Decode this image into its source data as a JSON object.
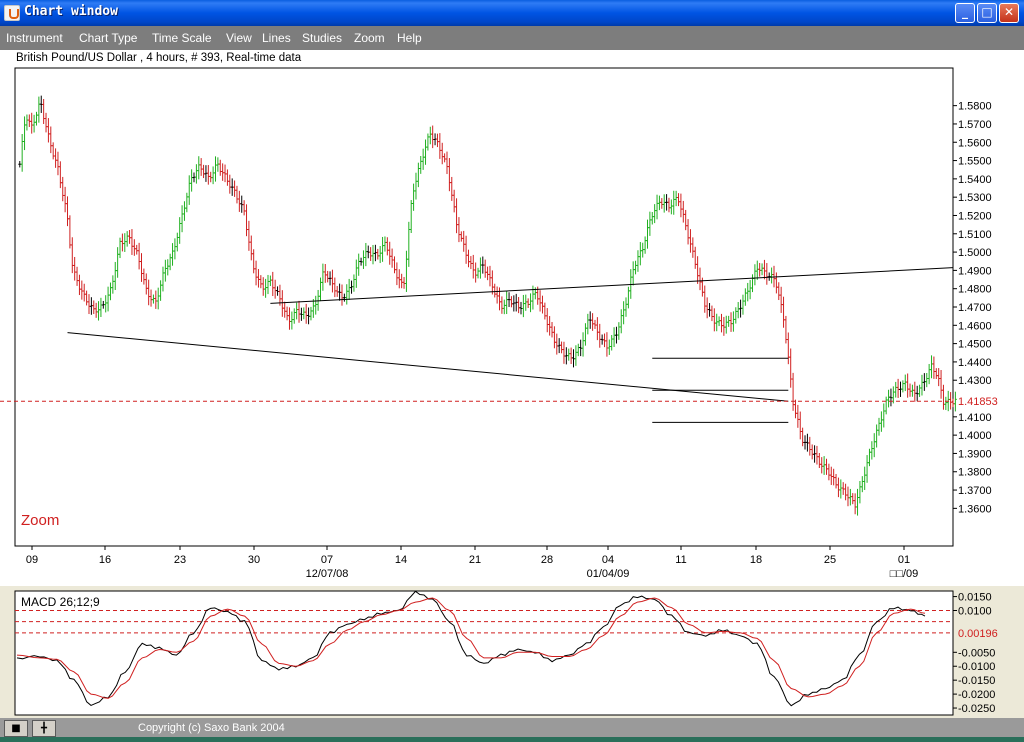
{
  "window": {
    "title": "Chart window"
  },
  "menu": [
    "Instrument",
    "Chart Type",
    "Time Scale",
    "View",
    "Lines",
    "Studies",
    "Zoom",
    "Help"
  ],
  "chart_header": "British Pound/US Dollar , 4 hours, # 393, Real-time data",
  "zoom_label": "Zoom",
  "macd_label": "MACD 26;12;9",
  "status": {
    "copyright": "Copyright (c) Saxo Bank 2004"
  },
  "colors": {
    "up_bar": "#20b020",
    "down_bar": "#d02020",
    "neutral_bar": "#000000",
    "ref_line": "#d02020",
    "signal": "#d02020"
  },
  "chart_data": [
    {
      "type": "ohlc",
      "instrument": "British Pound/US Dollar",
      "timeframe": "4 hours",
      "y_ticks": [
        "1.5800",
        "1.5700",
        "1.5600",
        "1.5500",
        "1.5400",
        "1.5300",
        "1.5200",
        "1.5100",
        "1.5000",
        "1.4900",
        "1.4800",
        "1.4700",
        "1.4600",
        "1.4500",
        "1.4400",
        "1.4300",
        "1.4100",
        "1.4000",
        "1.3900",
        "1.3800",
        "1.3700",
        "1.3600"
      ],
      "ylim": [
        1.352,
        1.588
      ],
      "x_ticks": [
        "09",
        "16",
        "23",
        "30",
        "07",
        "14",
        "21",
        "28",
        "04",
        "11",
        "18",
        "25",
        "01"
      ],
      "x_major": [
        "12/07/08",
        "01/04/09",
        "□□/09"
      ],
      "current_price": "1.41853",
      "current_value": 1.41853,
      "anchors": [
        [
          0,
          1.548
        ],
        [
          2,
          1.575
        ],
        [
          4,
          1.568
        ],
        [
          7,
          1.582
        ],
        [
          10,
          1.561
        ],
        [
          13,
          1.545
        ],
        [
          16,
          1.52
        ],
        [
          18,
          1.49
        ],
        [
          20,
          1.482
        ],
        [
          22,
          1.475
        ],
        [
          25,
          1.468
        ],
        [
          28,
          1.47
        ],
        [
          31,
          1.48
        ],
        [
          34,
          1.505
        ],
        [
          37,
          1.508
        ],
        [
          40,
          1.498
        ],
        [
          43,
          1.478
        ],
        [
          46,
          1.472
        ],
        [
          49,
          1.49
        ],
        [
          52,
          1.5
        ],
        [
          55,
          1.52
        ],
        [
          58,
          1.54
        ],
        [
          61,
          1.547
        ],
        [
          64,
          1.54
        ],
        [
          67,
          1.548
        ],
        [
          70,
          1.54
        ],
        [
          73,
          1.532
        ],
        [
          76,
          1.522
        ],
        [
          79,
          1.492
        ],
        [
          82,
          1.48
        ],
        [
          85,
          1.484
        ],
        [
          88,
          1.475
        ],
        [
          91,
          1.462
        ],
        [
          94,
          1.468
        ],
        [
          97,
          1.465
        ],
        [
          100,
          1.47
        ],
        [
          103,
          1.49
        ],
        [
          106,
          1.482
        ],
        [
          109,
          1.475
        ],
        [
          112,
          1.48
        ],
        [
          115,
          1.495
        ],
        [
          118,
          1.5
        ],
        [
          121,
          1.498
        ],
        [
          124,
          1.505
        ],
        [
          127,
          1.49
        ],
        [
          130,
          1.48
        ],
        [
          133,
          1.532
        ],
        [
          136,
          1.55
        ],
        [
          139,
          1.565
        ],
        [
          142,
          1.558
        ],
        [
          145,
          1.545
        ],
        [
          148,
          1.515
        ],
        [
          151,
          1.5
        ],
        [
          154,
          1.488
        ],
        [
          157,
          1.493
        ],
        [
          160,
          1.482
        ],
        [
          163,
          1.47
        ],
        [
          166,
          1.474
        ],
        [
          169,
          1.47
        ],
        [
          172,
          1.472
        ],
        [
          175,
          1.478
        ],
        [
          178,
          1.465
        ],
        [
          181,
          1.452
        ],
        [
          184,
          1.445
        ],
        [
          187,
          1.442
        ],
        [
          190,
          1.448
        ],
        [
          193,
          1.465
        ],
        [
          196,
          1.455
        ],
        [
          199,
          1.448
        ],
        [
          202,
          1.455
        ],
        [
          205,
          1.47
        ],
        [
          208,
          1.492
        ],
        [
          211,
          1.502
        ],
        [
          214,
          1.52
        ],
        [
          217,
          1.528
        ],
        [
          220,
          1.525
        ],
        [
          223,
          1.53
        ],
        [
          226,
          1.512
        ],
        [
          229,
          1.493
        ],
        [
          232,
          1.472
        ],
        [
          235,
          1.463
        ],
        [
          238,
          1.46
        ],
        [
          241,
          1.462
        ],
        [
          244,
          1.47
        ],
        [
          247,
          1.48
        ],
        [
          250,
          1.492
        ],
        [
          253,
          1.488
        ],
        [
          256,
          1.485
        ],
        [
          259,
          1.462
        ],
        [
          262,
          1.418
        ],
        [
          265,
          1.398
        ],
        [
          268,
          1.392
        ],
        [
          271,
          1.385
        ],
        [
          274,
          1.38
        ],
        [
          277,
          1.372
        ],
        [
          280,
          1.368
        ],
        [
          283,
          1.362
        ],
        [
          285,
          1.372
        ],
        [
          288,
          1.39
        ],
        [
          291,
          1.405
        ],
        [
          294,
          1.42
        ],
        [
          297,
          1.425
        ],
        [
          300,
          1.428
        ],
        [
          303,
          1.422
        ],
        [
          306,
          1.428
        ],
        [
          309,
          1.438
        ],
        [
          311,
          1.432
        ],
        [
          313,
          1.418
        ],
        [
          315,
          1.418
        ],
        [
          317,
          1.419
        ]
      ],
      "trendlines": [
        {
          "from": [
            105,
            1.472
          ],
          "to": [
            393,
            1.4915
          ]
        },
        {
          "from": [
            20,
            1.456
          ],
          "to": [
            322,
            1.4185
          ]
        },
        {
          "from": [
            265,
            1.442
          ],
          "to": [
            322,
            1.442
          ]
        },
        {
          "from": [
            265,
            1.4245
          ],
          "to": [
            322,
            1.4245
          ]
        },
        {
          "from": [
            265,
            1.407
          ],
          "to": [
            322,
            1.407
          ]
        }
      ]
    },
    {
      "type": "line",
      "title": "MACD 26;12;9",
      "y_ticks": [
        "0.0150",
        "0.0100",
        "-0.0050",
        "-0.0100",
        "-0.0150",
        "-0.0200",
        "-0.0250"
      ],
      "ylim": [
        -0.0275,
        0.017
      ],
      "current_value_label": "0.00196",
      "reference_levels": [
        0.01,
        0.006,
        0.00196
      ],
      "series": [
        {
          "values": [
            [
              0,
              -0.007
            ],
            [
              8,
              -0.0065
            ],
            [
              14,
              -0.008
            ],
            [
              20,
              -0.015
            ],
            [
              26,
              -0.024
            ],
            [
              32,
              -0.021
            ],
            [
              38,
              -0.012
            ],
            [
              44,
              -0.002
            ],
            [
              50,
              -0.0035
            ],
            [
              56,
              -0.006
            ],
            [
              62,
              0.002
            ],
            [
              68,
              0.011
            ],
            [
              74,
              0.0095
            ],
            [
              80,
              0.006
            ],
            [
              86,
              -0.008
            ],
            [
              92,
              -0.011
            ],
            [
              98,
              -0.01
            ],
            [
              104,
              -0.007
            ],
            [
              110,
              0.002
            ],
            [
              116,
              0.005
            ],
            [
              122,
              0.007
            ],
            [
              128,
              0.009
            ],
            [
              134,
              0.01
            ],
            [
              140,
              0.0165
            ],
            [
              146,
              0.014
            ],
            [
              152,
              0.006
            ],
            [
              158,
              -0.006
            ],
            [
              164,
              -0.009
            ],
            [
              170,
              -0.006
            ],
            [
              176,
              -0.004
            ],
            [
              182,
              -0.005
            ],
            [
              188,
              -0.008
            ],
            [
              194,
              -0.006
            ],
            [
              200,
              -0.002
            ],
            [
              206,
              0.004
            ],
            [
              212,
              0.012
            ],
            [
              218,
              0.015
            ],
            [
              224,
              0.014
            ],
            [
              230,
              0.008
            ],
            [
              236,
              0.002
            ],
            [
              242,
              0.001
            ],
            [
              248,
              0.003
            ],
            [
              254,
              0.001
            ],
            [
              260,
              -0.002
            ],
            [
              266,
              -0.014
            ],
            [
              272,
              -0.024
            ],
            [
              278,
              -0.02
            ],
            [
              284,
              -0.018
            ],
            [
              290,
              -0.015
            ],
            [
              296,
              -0.006
            ],
            [
              302,
              0.006
            ],
            [
              308,
              0.011
            ],
            [
              314,
              0.01
            ],
            [
              319,
              0.008
            ]
          ]
        },
        {
          "values": [
            [
              0,
              -0.006
            ],
            [
              8,
              -0.007
            ],
            [
              14,
              -0.0075
            ],
            [
              20,
              -0.012
            ],
            [
              26,
              -0.02
            ],
            [
              32,
              -0.0215
            ],
            [
              38,
              -0.016
            ],
            [
              44,
              -0.007
            ],
            [
              50,
              -0.004
            ],
            [
              56,
              -0.005
            ],
            [
              62,
              -0.001
            ],
            [
              68,
              0.008
            ],
            [
              74,
              0.0105
            ],
            [
              80,
              0.008
            ],
            [
              86,
              -0.002
            ],
            [
              92,
              -0.009
            ],
            [
              98,
              -0.01
            ],
            [
              104,
              -0.008
            ],
            [
              110,
              -0.002
            ],
            [
              116,
              0.003
            ],
            [
              122,
              0.006
            ],
            [
              128,
              0.0085
            ],
            [
              134,
              0.01
            ],
            [
              140,
              0.013
            ],
            [
              146,
              0.0145
            ],
            [
              152,
              0.01
            ],
            [
              158,
              0.0
            ],
            [
              164,
              -0.007
            ],
            [
              170,
              -0.007
            ],
            [
              176,
              -0.005
            ],
            [
              182,
              -0.005
            ],
            [
              188,
              -0.0065
            ],
            [
              194,
              -0.0065
            ],
            [
              200,
              -0.004
            ],
            [
              206,
              0.001
            ],
            [
              212,
              0.008
            ],
            [
              218,
              0.013
            ],
            [
              224,
              0.0145
            ],
            [
              230,
              0.011
            ],
            [
              236,
              0.005
            ],
            [
              242,
              0.002
            ],
            [
              248,
              0.0025
            ],
            [
              254,
              0.002
            ],
            [
              260,
              0.0
            ],
            [
              266,
              -0.008
            ],
            [
              272,
              -0.018
            ],
            [
              278,
              -0.021
            ],
            [
              284,
              -0.02
            ],
            [
              290,
              -0.017
            ],
            [
              296,
              -0.01
            ],
            [
              302,
              0.002
            ],
            [
              308,
              0.009
            ],
            [
              314,
              0.0105
            ],
            [
              319,
              0.009
            ]
          ]
        }
      ]
    }
  ]
}
